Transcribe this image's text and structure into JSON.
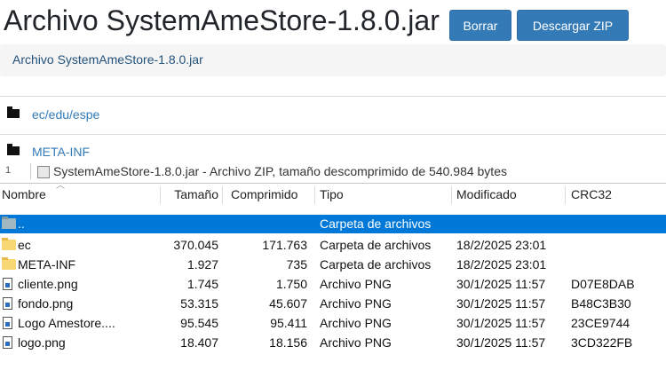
{
  "header": {
    "title": "Archivo SystemAmeStore-1.8.0.jar",
    "delete_label": "Borrar",
    "download_label": "Descargar ZIP"
  },
  "breadcrumb": {
    "label": "Archivo SystemAmeStore-1.8.0.jar"
  },
  "entries": [
    {
      "label": "ec/edu/espe",
      "icon": "folder-icon"
    },
    {
      "label": "META-INF",
      "icon": "folder-icon"
    }
  ],
  "explorer": {
    "status_left": "1",
    "status_text": "SystemAmeStore-1.8.0.jar - Archivo ZIP, tamaño descomprimido de 540.984 bytes",
    "columns": {
      "name": "Nombre",
      "size": "Tamaño",
      "compressed": "Comprimido",
      "type": "Tipo",
      "modified": "Modificado",
      "crc": "CRC32"
    },
    "rows": [
      {
        "icon": "parent-folder-icon",
        "name": "..",
        "size": "",
        "compressed": "",
        "type": "Carpeta de archivos",
        "modified": "",
        "crc": "",
        "selected": true
      },
      {
        "icon": "folder-icon",
        "name": "ec",
        "size": "370.045",
        "compressed": "171.763",
        "type": "Carpeta de archivos",
        "modified": "18/2/2025 23:01",
        "crc": ""
      },
      {
        "icon": "folder-icon",
        "name": "META-INF",
        "size": "1.927",
        "compressed": "735",
        "type": "Carpeta de archivos",
        "modified": "18/2/2025 23:01",
        "crc": ""
      },
      {
        "icon": "png-file-icon",
        "name": "cliente.png",
        "size": "1.745",
        "compressed": "1.750",
        "type": "Archivo PNG",
        "modified": "30/1/2025 11:57",
        "crc": "D07E8DAB"
      },
      {
        "icon": "png-file-icon",
        "name": "fondo.png",
        "size": "53.315",
        "compressed": "45.607",
        "type": "Archivo PNG",
        "modified": "30/1/2025 11:57",
        "crc": "B48C3B30"
      },
      {
        "icon": "png-file-icon",
        "name": "Logo Amestore....",
        "size": "95.545",
        "compressed": "95.411",
        "type": "Archivo PNG",
        "modified": "30/1/2025 11:57",
        "crc": "23CE9744"
      },
      {
        "icon": "png-file-icon",
        "name": "logo.png",
        "size": "18.407",
        "compressed": "18.156",
        "type": "Archivo PNG",
        "modified": "30/1/2025 11:57",
        "crc": "3CD322FB"
      }
    ]
  },
  "colors": {
    "accent": "#337ab7",
    "selection": "#0078d7"
  }
}
